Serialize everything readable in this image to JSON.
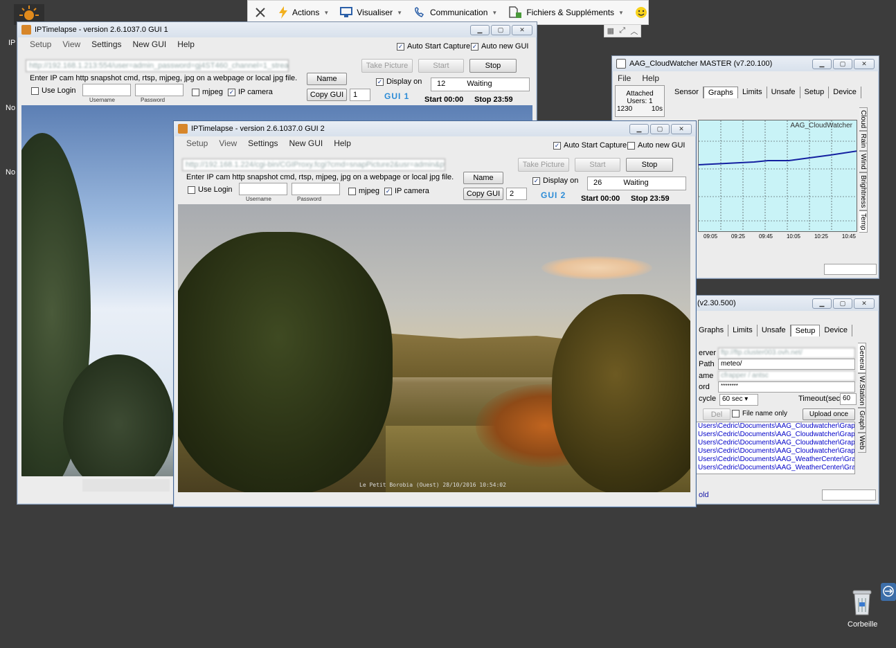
{
  "toolbar": {
    "actions": "Actions",
    "view": "Visualiser",
    "communication": "Communication",
    "files": "Fichiers & Suppléments"
  },
  "desktop": {
    "recycle_label": "Corbeille",
    "left_icon_1": "IP",
    "left_icon_2": "No",
    "left_icon_3": "No"
  },
  "ipt1": {
    "title": "IPTimelapse - version 2.6.1037.0     GUI 1",
    "menu": [
      "Setup",
      "View",
      "Settings",
      "New GUI",
      "Help"
    ],
    "auto_start": "Auto Start Capture",
    "auto_new": "Auto new GUI",
    "url_value": "http://192.168.1.213:554/user=admin_password=gj4ST460_channel=1_stream=0.sdp",
    "hint": "Enter IP cam http snapshot cmd, rtsp, mjpeg, jpg on a webpage or local jpg file.",
    "use_login": "Use Login",
    "username": "Username",
    "password": "Password",
    "mjpeg": "mjpeg",
    "ip_camera": "IP camera",
    "take_picture": "Take Picture",
    "start": "Start",
    "stop": "Stop",
    "name": "Name",
    "copy_gui": "Copy GUI",
    "gui_number": "1",
    "display_on": "Display on",
    "counter": "12",
    "status": "Waiting",
    "gui_label": "GUI  1",
    "start_time": "Start 00:00",
    "stop_time": "Stop 23:59"
  },
  "ipt2": {
    "title": "IPTimelapse - version 2.6.1037.0     GUI 2",
    "menu": [
      "Setup",
      "View",
      "Settings",
      "New GUI",
      "Help"
    ],
    "auto_start": "Auto Start Capture",
    "auto_new": "Auto new GUI",
    "url_value": "http://192.168.1.224/cgi-bin/CGIProxy.fcgi?cmd=snapPicture2&usr=admin&pwd=gh",
    "hint": "Enter IP cam http snapshot cmd, rtsp, mjpeg, jpg on a webpage or local jpg file.",
    "use_login": "Use Login",
    "username": "Username",
    "password": "Password",
    "mjpeg": "mjpeg",
    "ip_camera": "IP camera",
    "take_picture": "Take Picture",
    "start": "Start",
    "stop": "Stop",
    "name": "Name",
    "copy_gui": "Copy GUI",
    "gui_number": "2",
    "display_on": "Display on",
    "counter": "26",
    "status": "Waiting",
    "gui_label": "GUI  2",
    "start_time": "Start 00:00",
    "stop_time": "Stop 23:59",
    "stamp": "Le Petit Borobia (Ouest)  28/10/2016 10:54:02"
  },
  "cw1": {
    "title": "AAG_CloudWatcher MASTER (v7.20.100)",
    "menu": [
      "File",
      "Help"
    ],
    "attached": "Attached",
    "users": "Users: 1",
    "count": "1230",
    "interval": "10s",
    "tabs": [
      "Sensor",
      "Graphs",
      "Limits",
      "Unsafe",
      "Setup",
      "Device"
    ],
    "side_tabs": [
      "Cloud",
      "Rain",
      "Wind",
      "Brightness",
      "Temp"
    ],
    "graph_title": "AAG_CloudWatcher",
    "x_ticks": [
      "09:05",
      "09:25",
      "09:45",
      "10:05",
      "10:25",
      "10:45"
    ]
  },
  "cw2": {
    "title": "(v2.30.500)",
    "tabs": [
      "Graphs",
      "Limits",
      "Unsafe",
      "Setup",
      "Device"
    ],
    "side_tabs": [
      "General",
      "W.Station",
      "Graph",
      "Web"
    ],
    "server_label": "erver",
    "server_value": "ftp://ftp.cluster003.ovh.net/",
    "path_label": "Path",
    "path_value": "meteo/",
    "name_label": "ame",
    "name_value": "cfrapper / antsc",
    "word_label": "ord",
    "word_value": "********",
    "cycle_label": "cycle",
    "cycle_value": "60 sec",
    "timeout_label": "Timeout(sec)",
    "timeout_value": "60",
    "del": "Del",
    "file_name_only": "File name only",
    "upload_once": "Upload once",
    "paths": [
      "Users\\Cedric\\Documents\\AAG_Cloudwatcher\\Grap",
      "Users\\Cedric\\Documents\\AAG_Cloudwatcher\\Grap",
      "Users\\Cedric\\Documents\\AAG_Cloudwatcher\\Grap",
      "Users\\Cedric\\Documents\\AAG_Cloudwatcher\\Grap",
      "Users\\Cedric\\Documents\\AAG_WeatherCenter\\Gra",
      "Users\\Cedric\\Documents\\AAG_WeatherCenter\\Gra"
    ],
    "footer": "old"
  }
}
